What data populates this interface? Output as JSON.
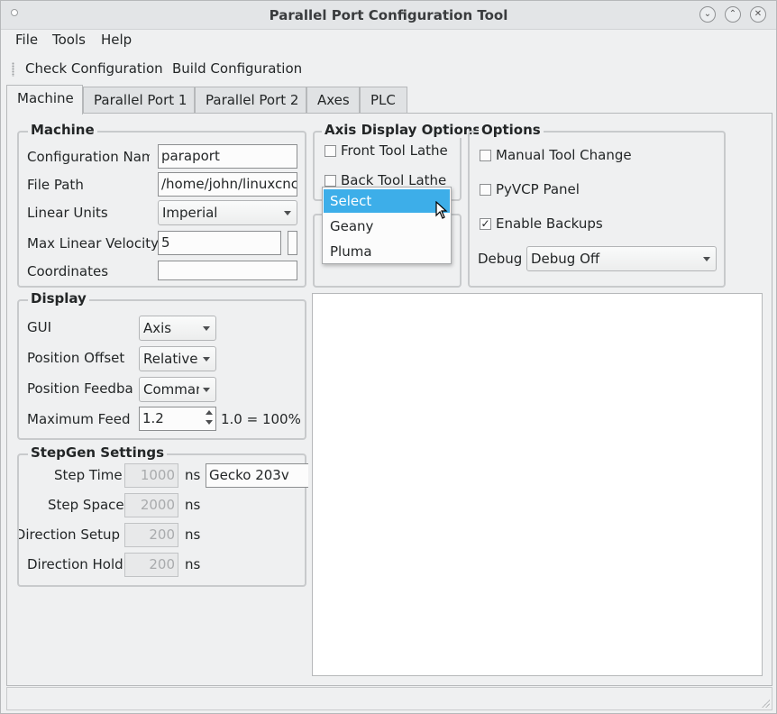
{
  "window": {
    "title": "Parallel Port Configuration Tool"
  },
  "menu": {
    "file": "File",
    "tools": "Tools",
    "help": "Help"
  },
  "toolbar": {
    "check": "Check Configuration",
    "build": "Build Configuration"
  },
  "tabs": [
    "Machine",
    "Parallel Port 1",
    "Parallel Port 2",
    "Axes",
    "PLC"
  ],
  "machine": {
    "title": "Machine",
    "config_name_label": "Configuration Name",
    "config_name_value": "paraport",
    "file_path_label": "File Path",
    "file_path_value": "/home/john/linuxcnc/",
    "linear_units_label": "Linear Units",
    "linear_units_value": "Imperial",
    "max_vel_label": "Max Linear Velocity",
    "max_vel_value": "5",
    "coordinates_label": "Coordinates",
    "coordinates_value": ""
  },
  "axis_display": {
    "title": "Axis Display Options",
    "front": "Front Tool Lathe",
    "back": "Back Tool Lathe"
  },
  "options": {
    "title": "Options",
    "manual_tool": "Manual Tool Change",
    "pyvcp": "PyVCP Panel",
    "backups": "Enable Backups",
    "backups_checked": "✓",
    "debug_label": "Debug",
    "debug_value": "Debug Off"
  },
  "editor_popup": {
    "items": [
      "Select",
      "Geany",
      "Pluma"
    ]
  },
  "display": {
    "title": "Display",
    "gui_label": "GUI",
    "gui_value": "Axis",
    "pos_offset_label": "Position Offset",
    "pos_offset_value": "Relative",
    "pos_feedback_label": "Position Feedback",
    "pos_feedback_value": "Commanded",
    "max_feed_label": "Maximum Feed Override",
    "max_feed_value": "1.2",
    "max_feed_note": "1.0 = 100%"
  },
  "stepgen": {
    "title": "StepGen Settings",
    "step_time_label": "Step Time",
    "step_time_value": "1000",
    "step_space_label": "Step Space",
    "step_space_value": "2000",
    "dir_setup_label": "Direction Setup",
    "dir_setup_value": "200",
    "dir_hold_label": "Direction Hold",
    "dir_hold_value": "200",
    "unit": "ns",
    "drive_value": "Gecko 203v"
  }
}
